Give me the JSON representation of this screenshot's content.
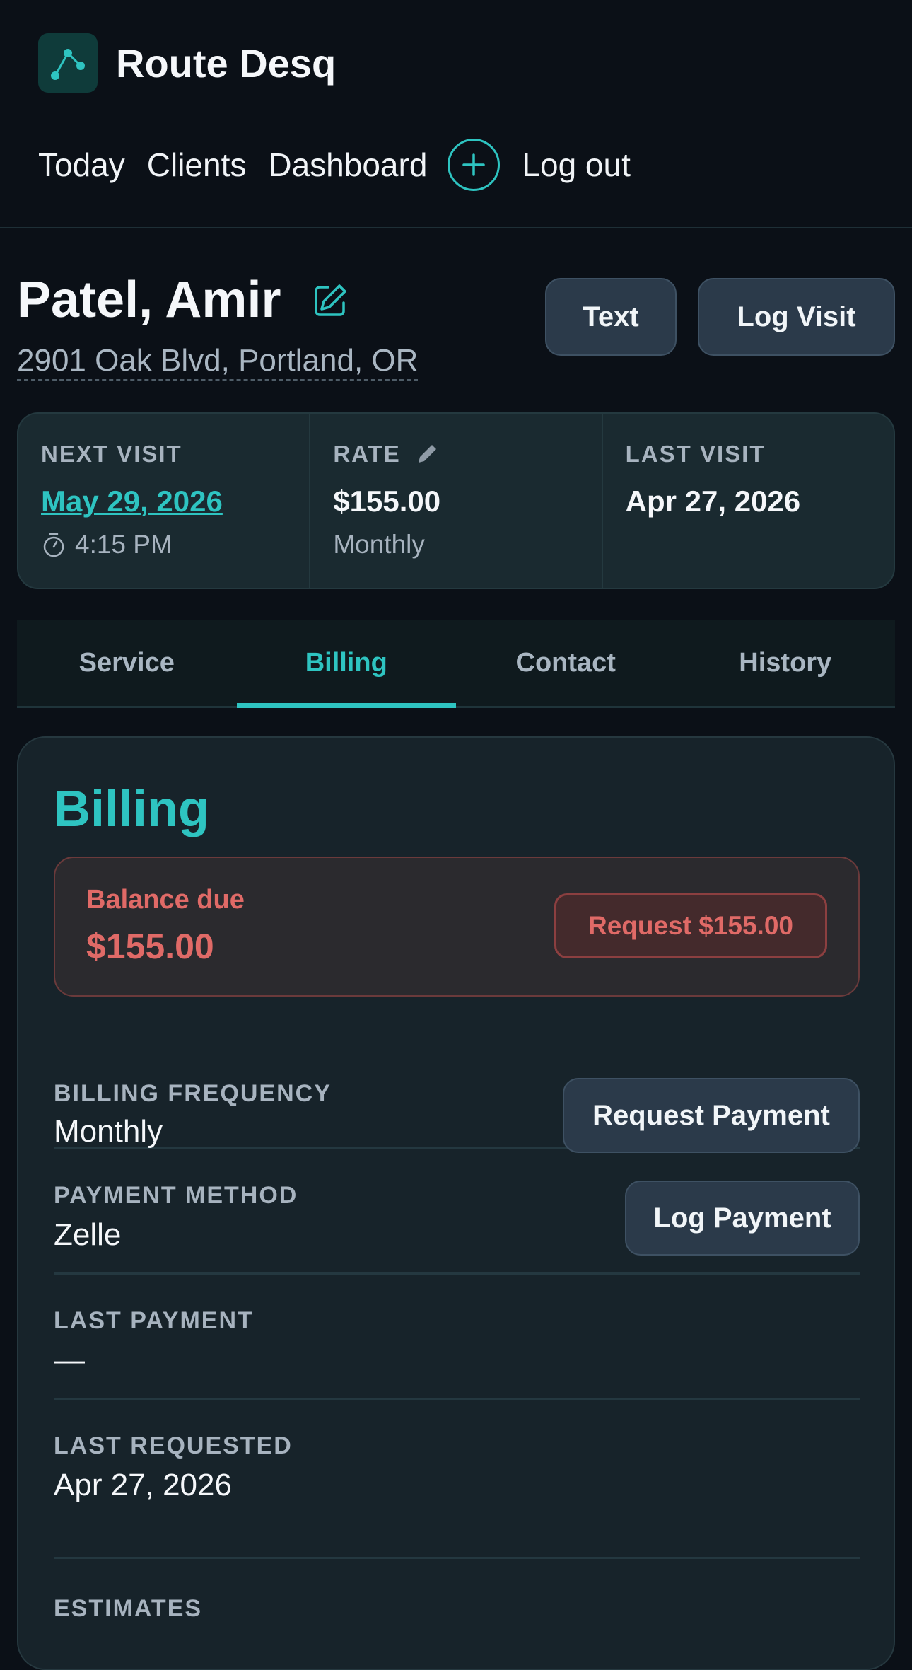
{
  "app": {
    "name": "Route Desq"
  },
  "nav": {
    "items": [
      "Today",
      "Clients",
      "Dashboard"
    ],
    "add_icon": "plus-circle-icon",
    "logout": "Log out"
  },
  "client": {
    "name": "Patel, Amir",
    "address": "2901 Oak Blvd, Portland, OR",
    "actions": {
      "text": "Text",
      "log_visit": "Log Visit"
    }
  },
  "summary": {
    "next_visit": {
      "label": "NEXT VISIT",
      "date": "May 29, 2026",
      "time": "4:15 PM"
    },
    "rate": {
      "label": "RATE",
      "amount": "$155.00",
      "frequency": "Monthly"
    },
    "last_visit": {
      "label": "LAST VISIT",
      "date": "Apr 27, 2026"
    }
  },
  "tabs": {
    "items": [
      "Service",
      "Billing",
      "Contact",
      "History"
    ],
    "active": "Billing"
  },
  "billing": {
    "title": "Billing",
    "balance": {
      "label": "Balance due",
      "amount": "$155.00",
      "request_button": "Request $155.00"
    },
    "frequency": {
      "label": "BILLING FREQUENCY",
      "value": "Monthly",
      "button": "Request Payment"
    },
    "method": {
      "label": "PAYMENT METHOD",
      "value": "Zelle",
      "button": "Log Payment"
    },
    "last_payment": {
      "label": "LAST PAYMENT",
      "value": "—"
    },
    "last_requested": {
      "label": "LAST REQUESTED",
      "value": "Apr 27, 2026"
    },
    "estimates": {
      "label": "ESTIMATES"
    }
  },
  "colors": {
    "background": "#0b1017",
    "accent": "#2ec4c1",
    "danger": "#e06a67",
    "card": "#17232a"
  }
}
